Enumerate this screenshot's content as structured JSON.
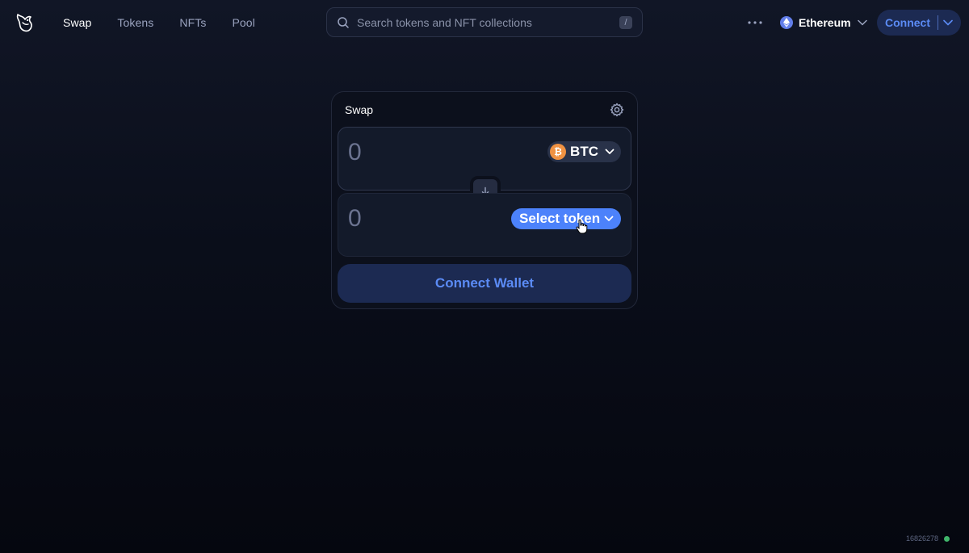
{
  "header": {
    "nav": [
      {
        "label": "Swap",
        "active": true
      },
      {
        "label": "Tokens",
        "active": false
      },
      {
        "label": "NFTs",
        "active": false
      },
      {
        "label": "Pool",
        "active": false
      }
    ],
    "search": {
      "placeholder": "Search tokens and NFT collections",
      "shortcut": "/"
    },
    "network": {
      "label": "Ethereum",
      "icon": "ethereum-icon"
    },
    "connect_label": "Connect"
  },
  "swap": {
    "title": "Swap",
    "input": {
      "amount_placeholder": "0",
      "token": "BTC",
      "token_icon": "bitcoin-icon"
    },
    "output": {
      "amount_placeholder": "0",
      "select_label": "Select token"
    },
    "connect_wallet_label": "Connect Wallet"
  },
  "footer": {
    "block_number": "16826278",
    "status_color": "#40b66b"
  },
  "colors": {
    "accent": "#4c82fb",
    "accent_text": "#5b8bf5",
    "btc": "#f09242",
    "eth": "#627eea"
  }
}
